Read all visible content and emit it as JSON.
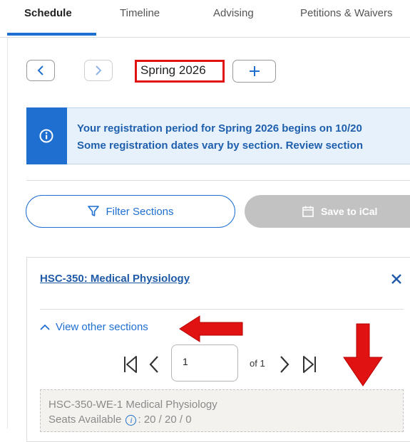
{
  "tabs": [
    {
      "label": "Schedule",
      "active": true
    },
    {
      "label": "Timeline",
      "active": false
    },
    {
      "label": "Advising",
      "active": false
    },
    {
      "label": "Petitions & Waivers",
      "active": false
    }
  ],
  "term": {
    "current": "Spring 2026"
  },
  "banner": {
    "line1": "Your registration period for Spring 2026 begins on 10/20",
    "line2": "Some registration dates vary by section. Review section"
  },
  "actions": {
    "filter_label": "Filter Sections",
    "ical_label": "Save to iCal"
  },
  "course": {
    "title": "HSC-350: Medical Physiology",
    "view_other": "View other sections",
    "pager": {
      "current": "1",
      "total_text": "of 1"
    },
    "section": {
      "name": "HSC-350-WE-1 Medical Physiology",
      "seats_label": "Seats Available",
      "seats_value": ": 20 / 20 / 0"
    }
  },
  "colors": {
    "accent": "#1f6fd1",
    "highlight": "#e01212"
  },
  "icons": [
    "chevron-left-icon",
    "chevron-right-icon",
    "plus-icon",
    "info-icon",
    "filter-icon",
    "calendar-icon",
    "close-icon",
    "chevron-up-icon",
    "first-page-icon",
    "last-page-icon",
    "arrow-left-annotation",
    "arrow-down-annotation"
  ]
}
